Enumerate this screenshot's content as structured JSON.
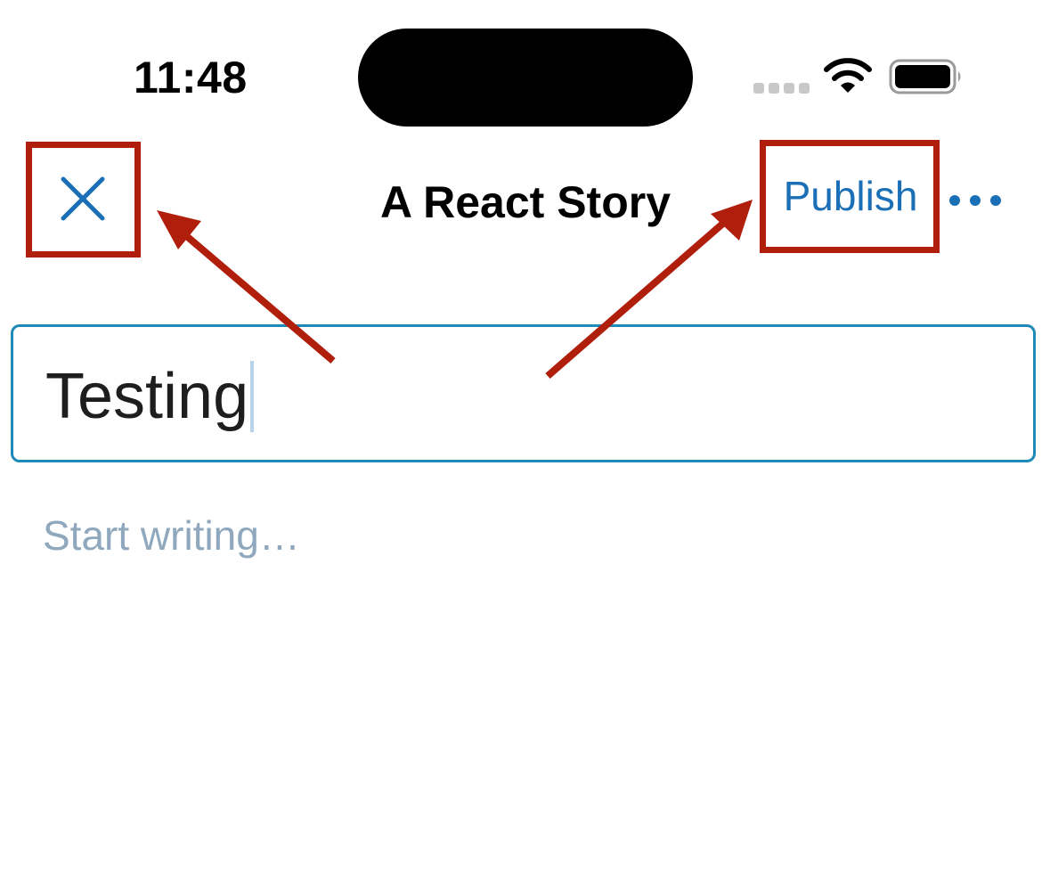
{
  "status_bar": {
    "time": "11:48"
  },
  "nav_bar": {
    "title": "A React Story",
    "publish_label": "Publish",
    "close_icon": "close-icon",
    "more_icon": "more-horizontal-icon"
  },
  "editor": {
    "title_value": "Testing",
    "body_placeholder": "Start writing…"
  },
  "colors": {
    "accent": "#1a6fb6",
    "input_border": "#1e8ab8",
    "placeholder": "#8fa8bd",
    "annotation": "#b01e0c"
  }
}
